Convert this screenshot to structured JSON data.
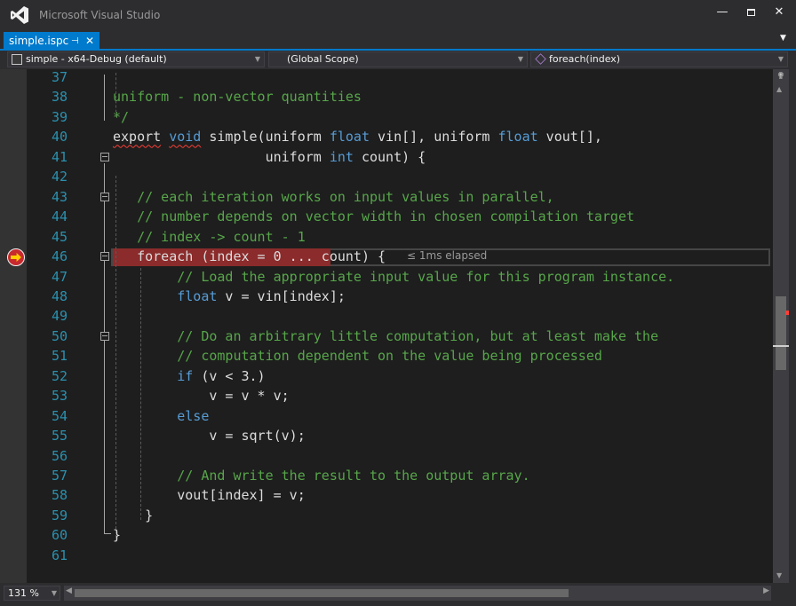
{
  "window": {
    "title": "Microsoft Visual Studio"
  },
  "tab": {
    "label": "simple.ispc"
  },
  "nav": {
    "project": "simple - x64-Debug (default)",
    "scope": "(Global Scope)",
    "member": "foreach(index)"
  },
  "editor": {
    "perf_tip": "≤ 1ms elapsed",
    "zoom": "131 %"
  },
  "colors": {
    "keyword": "#569cd6",
    "comment": "#57a64a",
    "line_number": "#2b91af",
    "breakpoint": "#8b2b2b",
    "accent": "#007acc"
  },
  "lines": [
    {
      "num": "37",
      "parts": []
    },
    {
      "num": "38",
      "parts": [
        {
          "t": "uniform - non-vector quantities",
          "c": "cm"
        }
      ]
    },
    {
      "num": "39",
      "parts": [
        {
          "t": "*/",
          "c": "cm"
        }
      ]
    },
    {
      "num": "40",
      "parts": [
        {
          "t": "export",
          "c": "sq"
        },
        {
          "t": " "
        },
        {
          "t": "void",
          "c": "kw sq"
        },
        {
          "t": " simple(uniform "
        },
        {
          "t": "float",
          "c": "kw"
        },
        {
          "t": " vin[], uniform "
        },
        {
          "t": "float",
          "c": "kw"
        },
        {
          "t": " vout[],"
        }
      ]
    },
    {
      "num": "41",
      "parts": [
        {
          "t": "                   uniform "
        },
        {
          "t": "int",
          "c": "kw"
        },
        {
          "t": " count) {"
        }
      ]
    },
    {
      "num": "42",
      "parts": []
    },
    {
      "num": "43",
      "parts": [
        {
          "t": "   "
        },
        {
          "t": "// each iteration works on input values in parallel,",
          "c": "cm"
        }
      ]
    },
    {
      "num": "44",
      "parts": [
        {
          "t": "   "
        },
        {
          "t": "// number depends on vector width in chosen compilation target",
          "c": "cm"
        }
      ]
    },
    {
      "num": "45",
      "parts": [
        {
          "t": "   "
        },
        {
          "t": "// index -> count - 1",
          "c": "cm"
        }
      ]
    },
    {
      "num": "46",
      "parts": [
        {
          "t": "   foreach (index = 0 ... count) {"
        }
      ]
    },
    {
      "num": "47",
      "parts": [
        {
          "t": "        "
        },
        {
          "t": "// Load the appropriate input value for this program instance.",
          "c": "cm"
        }
      ]
    },
    {
      "num": "48",
      "parts": [
        {
          "t": "        "
        },
        {
          "t": "float",
          "c": "kw"
        },
        {
          "t": " v = vin[index];"
        }
      ]
    },
    {
      "num": "49",
      "parts": []
    },
    {
      "num": "50",
      "parts": [
        {
          "t": "        "
        },
        {
          "t": "// Do an arbitrary little computation, but at least make the",
          "c": "cm"
        }
      ]
    },
    {
      "num": "51",
      "parts": [
        {
          "t": "        "
        },
        {
          "t": "// computation dependent on the value being processed",
          "c": "cm"
        }
      ]
    },
    {
      "num": "52",
      "parts": [
        {
          "t": "        "
        },
        {
          "t": "if",
          "c": "kw"
        },
        {
          "t": " (v < 3.)"
        }
      ]
    },
    {
      "num": "53",
      "parts": [
        {
          "t": "            v = v * v;"
        }
      ]
    },
    {
      "num": "54",
      "parts": [
        {
          "t": "        "
        },
        {
          "t": "else",
          "c": "kw"
        }
      ]
    },
    {
      "num": "55",
      "parts": [
        {
          "t": "            v = sqrt(v);"
        }
      ]
    },
    {
      "num": "56",
      "parts": []
    },
    {
      "num": "57",
      "parts": [
        {
          "t": "        "
        },
        {
          "t": "// And write the result to the output array.",
          "c": "cm"
        }
      ]
    },
    {
      "num": "58",
      "parts": [
        {
          "t": "        vout[index] = v;"
        }
      ]
    },
    {
      "num": "59",
      "parts": [
        {
          "t": "    }"
        }
      ]
    },
    {
      "num": "60",
      "parts": [
        {
          "t": "}"
        }
      ]
    },
    {
      "num": "61",
      "parts": []
    }
  ]
}
